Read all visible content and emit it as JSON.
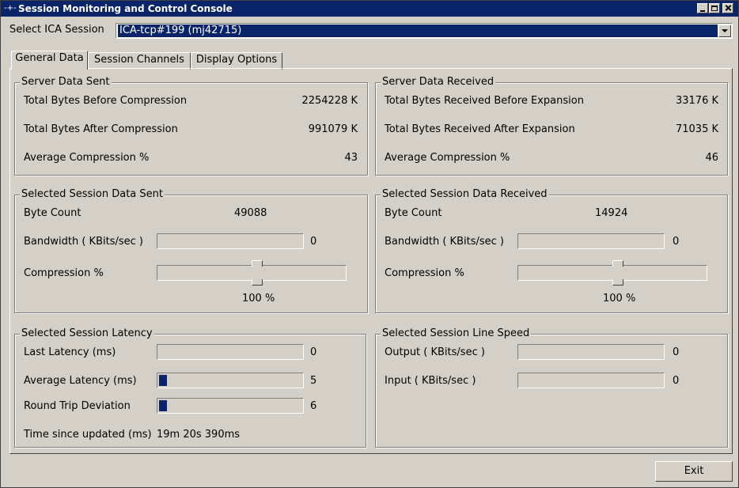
{
  "window": {
    "title": "Session Monitoring and Control Console",
    "title_icon": "network-icon"
  },
  "session_select": {
    "label": "Select ICA Session",
    "value": "ICA-tcp#199 (mj42715)"
  },
  "tabs": [
    {
      "label": "General Data",
      "active": true
    },
    {
      "label": "Session Channels",
      "active": false
    },
    {
      "label": "Display Options",
      "active": false
    }
  ],
  "server_sent": {
    "title": "Server Data Sent",
    "rows": [
      {
        "label": "Total Bytes Before Compression",
        "value": "2254228 K"
      },
      {
        "label": "Total Bytes After Compression",
        "value": "991079 K"
      },
      {
        "label": "Average Compression %",
        "value": "43"
      }
    ]
  },
  "server_received": {
    "title": "Server Data Received",
    "rows": [
      {
        "label": "Total Bytes Received Before Expansion",
        "value": "33176 K"
      },
      {
        "label": "Total Bytes Received After Expansion",
        "value": "71035 K"
      },
      {
        "label": "Average Compression %",
        "value": "46"
      }
    ]
  },
  "session_sent": {
    "title": "Selected Session Data Sent",
    "byte_count_label": "Byte Count",
    "byte_count": "49088",
    "bandwidth_label": "Bandwidth ( KBits/sec )",
    "bandwidth_value": "0",
    "bandwidth_level": 0,
    "compression_label": "Compression %",
    "compression_value": "100 %",
    "compression_level": 0.5
  },
  "session_received": {
    "title": "Selected Session Data Received",
    "byte_count_label": "Byte Count",
    "byte_count": "14924",
    "bandwidth_label": "Bandwidth ( KBits/sec )",
    "bandwidth_value": "0",
    "bandwidth_level": 0,
    "compression_label": "Compression %",
    "compression_value": "100 %",
    "compression_level": 0.5
  },
  "latency": {
    "title": "Selected Session Latency",
    "last_label": "Last Latency (ms)",
    "last_value": "0",
    "last_level": 0,
    "avg_label": "Average Latency (ms)",
    "avg_value": "5",
    "avg_level": 0.05,
    "rtd_label": "Round Trip Deviation",
    "rtd_value": "6",
    "rtd_level": 0.05,
    "updated_label": "Time since updated (ms)",
    "updated_value": "19m 20s 390ms"
  },
  "line_speed": {
    "title": "Selected Session Line Speed",
    "output_label": "Output ( KBits/sec )",
    "output_value": "0",
    "output_level": 0,
    "input_label": "Input ( KBits/sec )",
    "input_value": "0",
    "input_level": 0
  },
  "exit_button": "Exit",
  "colors": {
    "face": "#d4d0c8",
    "titlebar": "#0a246a",
    "progress_fill": "#0a246a"
  }
}
